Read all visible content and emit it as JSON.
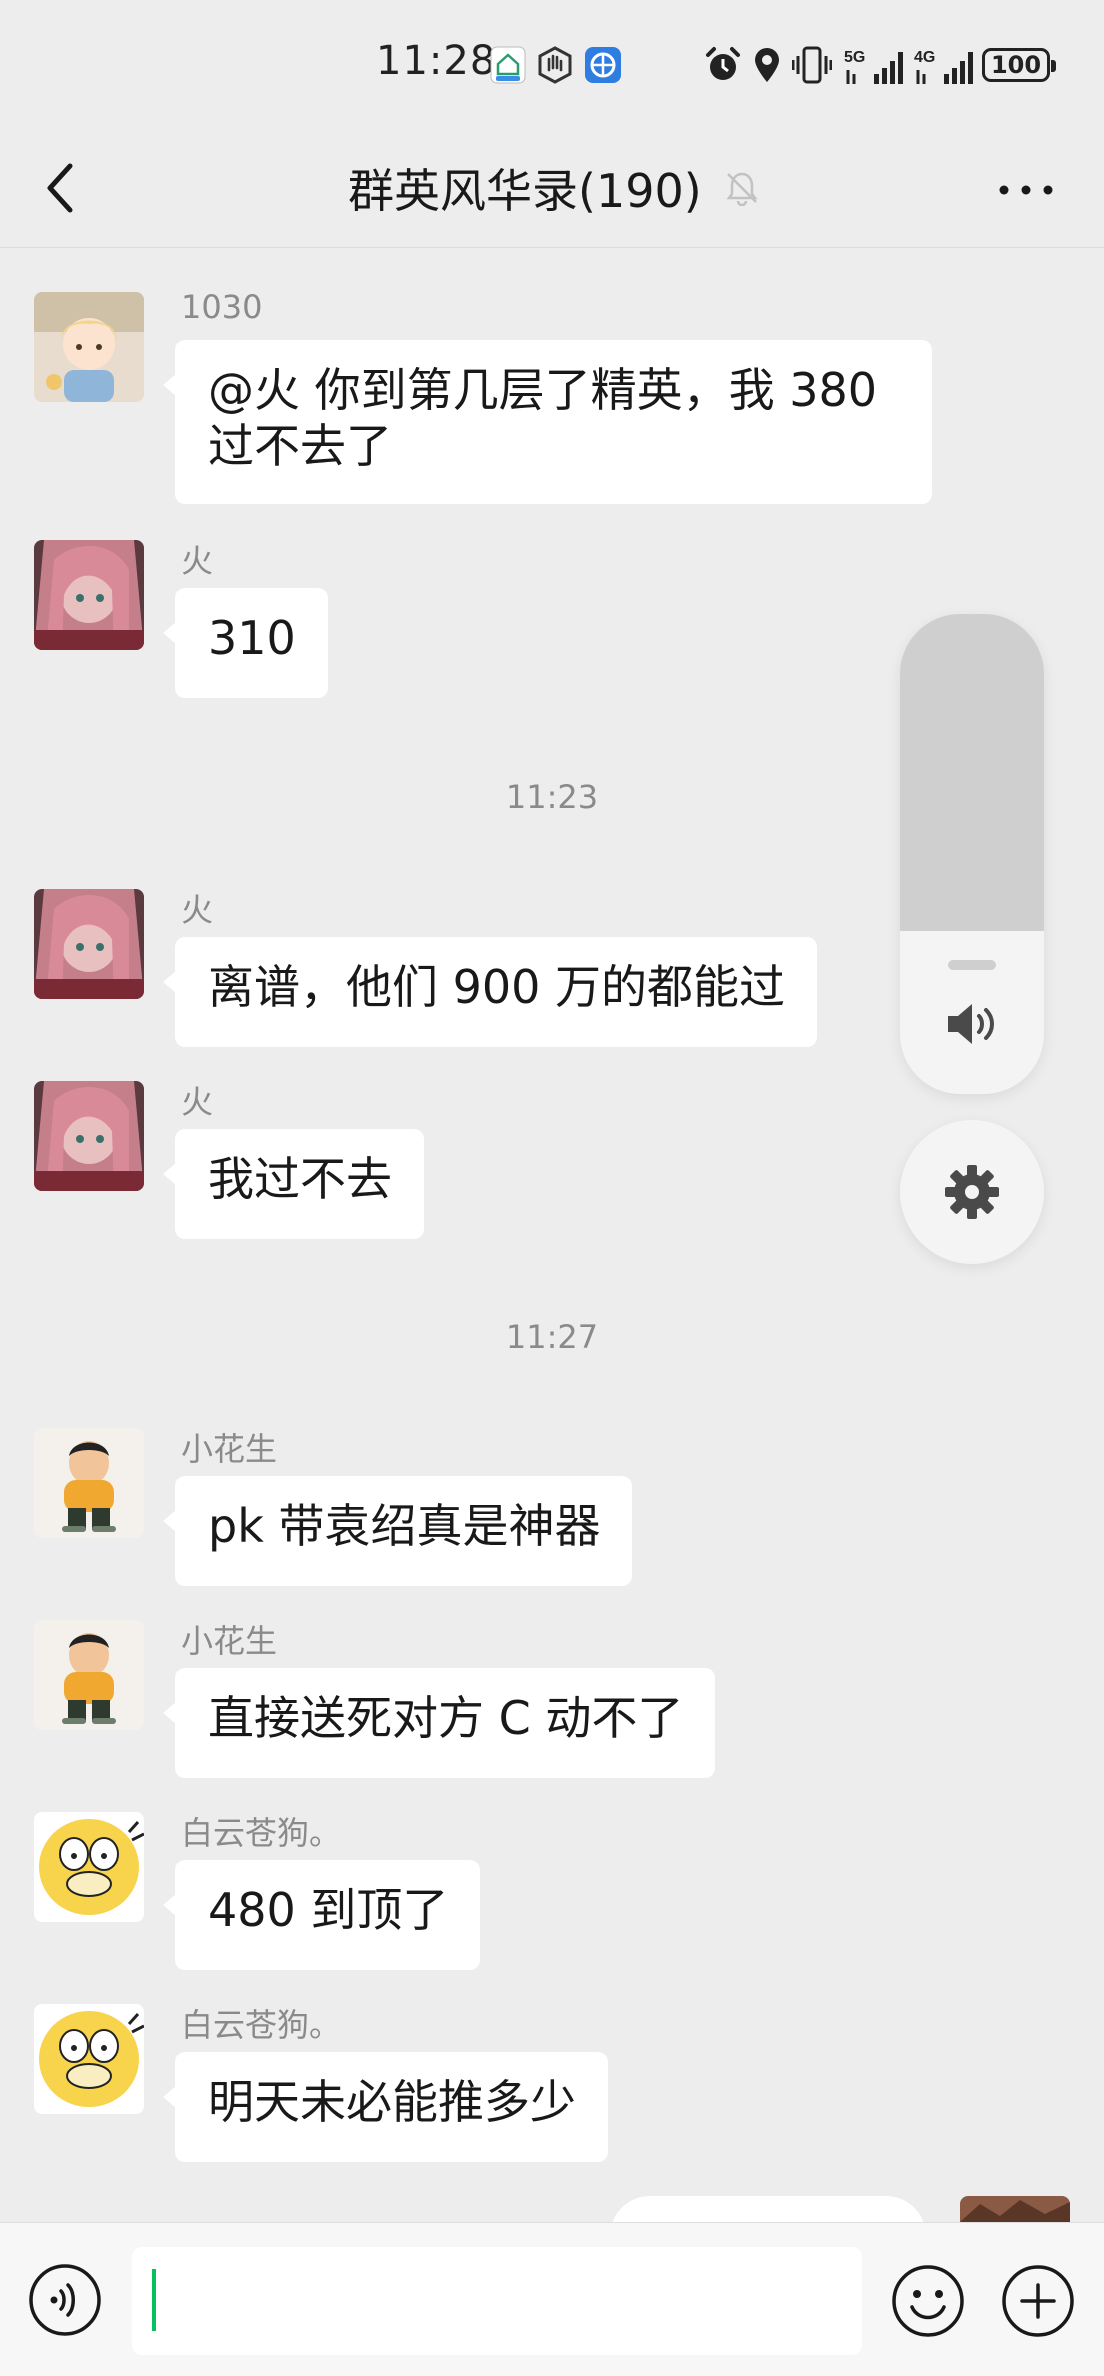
{
  "status_bar": {
    "time": "11:28",
    "battery": "100",
    "network_1": "5G",
    "network_2": "4G"
  },
  "header": {
    "title": "群英风华录(190)"
  },
  "messages": [
    {
      "sender": "1030",
      "text": "@火  你到第几层了精英，我 380\n过不去了",
      "avatar": "blonde-child-avatar"
    },
    {
      "sender": "火",
      "text": "310",
      "avatar": "pink-hair-anime-avatar"
    },
    {
      "time": "11:23"
    },
    {
      "sender": "火",
      "text": "离谱，他们 900 万的都能过",
      "avatar": "pink-hair-anime-avatar"
    },
    {
      "sender": "火",
      "text": "我过不去",
      "avatar": "pink-hair-anime-avatar"
    },
    {
      "time": "11:27"
    },
    {
      "sender": "小花生",
      "text": "pk 带袁绍真是神器",
      "avatar": "cartoon-boy-avatar"
    },
    {
      "sender": "小花生",
      "text": "直接送死对方 C 动不了",
      "avatar": "cartoon-boy-avatar"
    },
    {
      "sender": "白云苍狗。",
      "text": "480 到顶了",
      "avatar": "psyduck-avatar"
    },
    {
      "sender": "白云苍狗。",
      "text": "明天未必能推多少",
      "avatar": "psyduck-avatar"
    }
  ],
  "volume": {
    "level": 0.34
  },
  "input": {
    "value": ""
  },
  "colors": {
    "background": "#ededed",
    "bubble": "#ffffff",
    "accent_caret": "#07c160"
  }
}
